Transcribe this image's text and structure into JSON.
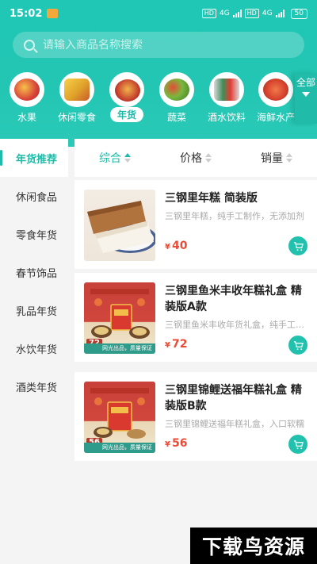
{
  "status": {
    "time": "15:02",
    "net1": "HD",
    "net2": "HD",
    "sig1": "4G",
    "sig2": "4G",
    "battery": "50"
  },
  "search": {
    "placeholder": "请输入商品名称搜索"
  },
  "categories": [
    {
      "label": "水果",
      "icon": "fruit-icon",
      "color": "#d9433a"
    },
    {
      "label": "休闲零食",
      "icon": "snack-icon",
      "color": "#e0a22a"
    },
    {
      "label": "年货",
      "icon": "new-year-goods-icon",
      "color": "#c33a2c",
      "active": true
    },
    {
      "label": "蔬菜",
      "icon": "vegetable-icon",
      "color": "#5a9e36"
    },
    {
      "label": "酒水饮料",
      "icon": "drinks-icon",
      "color": "#3f8e5a"
    },
    {
      "label": "海鲜水产",
      "icon": "seafood-icon",
      "color": "#d8452f"
    }
  ],
  "category_all": {
    "label": "全部"
  },
  "sidebar": {
    "items": [
      {
        "label": "年货推荐",
        "active": true
      },
      {
        "label": "休闲食品"
      },
      {
        "label": "零食年货"
      },
      {
        "label": "春节饰品"
      },
      {
        "label": "乳品年货"
      },
      {
        "label": "水饮年货"
      },
      {
        "label": "酒类年货"
      }
    ]
  },
  "sort": {
    "items": [
      {
        "label": "综合",
        "active": true
      },
      {
        "label": "价格"
      },
      {
        "label": "销量"
      }
    ]
  },
  "products": [
    {
      "title": "三钢里年糕 简装版",
      "desc": "三钢里年糕，纯手工制作，无添加剂",
      "currency": "¥",
      "price": "40"
    },
    {
      "title": "三钢里鱼米丰收年糕礼盒 精装版A款",
      "desc": "三钢里鱼米丰收年货礼盒，纯手工制作",
      "currency": "¥",
      "price": "72",
      "image_price": "72",
      "image_tag": "网光出品，质量保证"
    },
    {
      "title": "三钢里锦鲤送福年糕礼盒 精装版B款",
      "desc": "三钢里锦鲤送福年糕礼盒，入口软糯",
      "currency": "¥",
      "price": "56",
      "image_price": "56",
      "image_tag": "网光出品，质量保证"
    }
  ],
  "watermark": {
    "text": "下载鸟资源"
  },
  "colors": {
    "accent": "#1dbca9",
    "price": "#e84b38"
  }
}
